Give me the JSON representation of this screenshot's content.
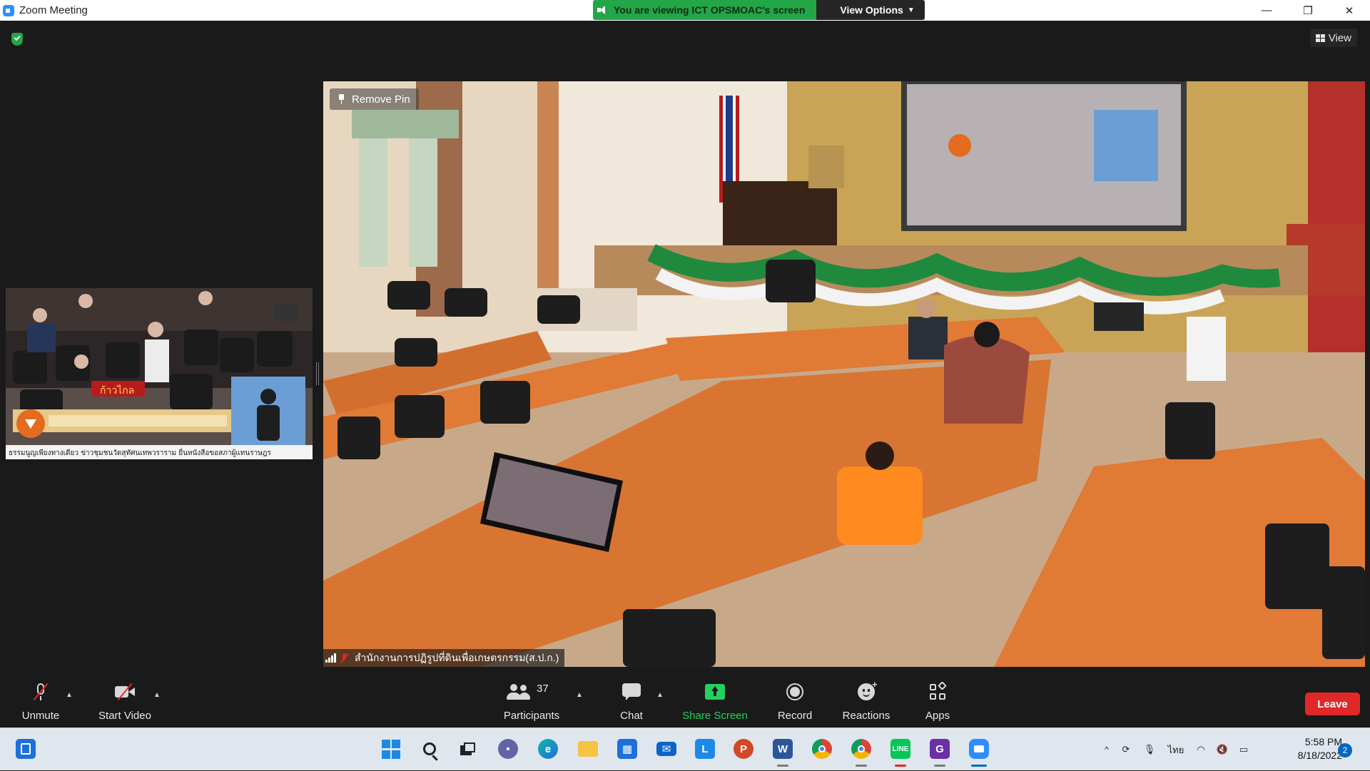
{
  "window": {
    "title": "Zoom Meeting",
    "share_banner": "You are viewing ICT OPSMOAC's screen",
    "view_options": "View Options",
    "controls": {
      "minimize": "—",
      "restore": "❐",
      "close": "✕"
    }
  },
  "meeting": {
    "view_label": "View",
    "remove_pin": "Remove Pin",
    "participant_name": "สำนักงานการปฏิรูปที่ดินเพื่อเกษตรกรรม(ส.ป.ก.)",
    "thumbnail_caption": "ธรรมนูญเพียงทางเดียว   ข่าวชุมชนวัดสุทัศนเทพวราราม ยื่นหนังสือขอสภาผู้แทนราษฎร",
    "thumbnail_banner": "ก้าวไกล"
  },
  "toolbar": {
    "unmute": "Unmute",
    "start_video": "Start Video",
    "participants": "Participants",
    "participants_count": "37",
    "chat": "Chat",
    "share_screen": "Share Screen",
    "record": "Record",
    "reactions": "Reactions",
    "apps": "Apps",
    "leave": "Leave"
  },
  "taskbar": {
    "icons": [
      "widgets-icon",
      "start-icon",
      "search-icon",
      "task-view-icon",
      "teams-chat-icon",
      "edge-icon",
      "file-explorer-icon",
      "store-icon",
      "mail-icon",
      "l-app-icon",
      "powerpoint-icon",
      "word-icon",
      "chrome-icon",
      "chrome-profile-icon",
      "line-icon",
      "pdf-app-icon",
      "zoom-icon"
    ],
    "language": "ไทย",
    "time": "5:58 PM",
    "date": "8/18/2022",
    "notifications": "2"
  },
  "colors": {
    "accent_green": "#23a647",
    "share_green": "#23d160",
    "leave_red": "#e02828",
    "toolbar_bg": "#1a1a1a",
    "taskbar_bg": "#dfe6ee"
  }
}
